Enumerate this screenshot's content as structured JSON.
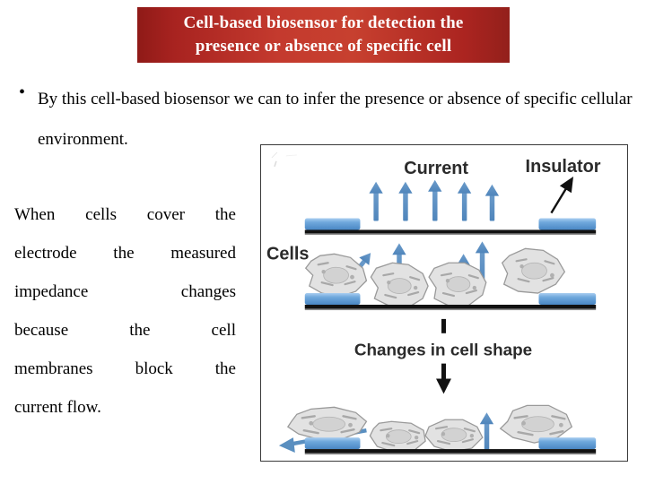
{
  "slide": {
    "background_color": "#ffffff"
  },
  "title": {
    "line1": "Cell-based biosensor for detection the",
    "line2": "presence or absence of specific cell",
    "gradient_dark": "#8f1a17",
    "gradient_light": "#c7402f",
    "text_color": "#ffffff"
  },
  "bullet": {
    "marker": "•",
    "text": "By this cell-based biosensor we can to infer the presence or absence of specific cellular environment."
  },
  "left_column": {
    "lines": [
      {
        "words": [
          "When",
          "cells",
          "cover",
          "the"
        ],
        "justified": true
      },
      {
        "words": [
          "electrode",
          "the",
          "measured"
        ],
        "justified": true
      },
      {
        "words": [
          "impedance",
          "changes"
        ],
        "justified": true
      },
      {
        "words": [
          "because",
          "the",
          "cell"
        ],
        "justified": true
      },
      {
        "words": [
          "membranes",
          "block",
          "the"
        ],
        "justified": true
      },
      {
        "words": [
          "current flow."
        ],
        "justified": false
      }
    ]
  },
  "figure": {
    "alt": "Cell-based impedance biosensor diagram",
    "colors": {
      "arrow_blue": "#5a8fc0",
      "electrode_blue": "#6fa8dc",
      "substrate_black": "#111111",
      "cell_fill": "#e2e2e2",
      "cell_stroke": "#9a9a9a",
      "label_gray": "#2b2b2b"
    },
    "panels": [
      {
        "name": "bare-electrode-panel",
        "labels": [
          "Current",
          "Insulator"
        ],
        "current_arrow_count": 5,
        "insulator_arrow": true
      },
      {
        "name": "cells-on-electrode-panel",
        "labels": [
          "Cells"
        ],
        "cell_count": 4,
        "blue_arrow_count": 4
      },
      {
        "name": "transition-panel",
        "labels": [
          "Changes in cell shape"
        ],
        "down_arrow": true
      },
      {
        "name": "flattened-cells-panel",
        "labels": [],
        "cell_count": 4,
        "left_arrow": true,
        "up_arrow": true
      }
    ]
  }
}
